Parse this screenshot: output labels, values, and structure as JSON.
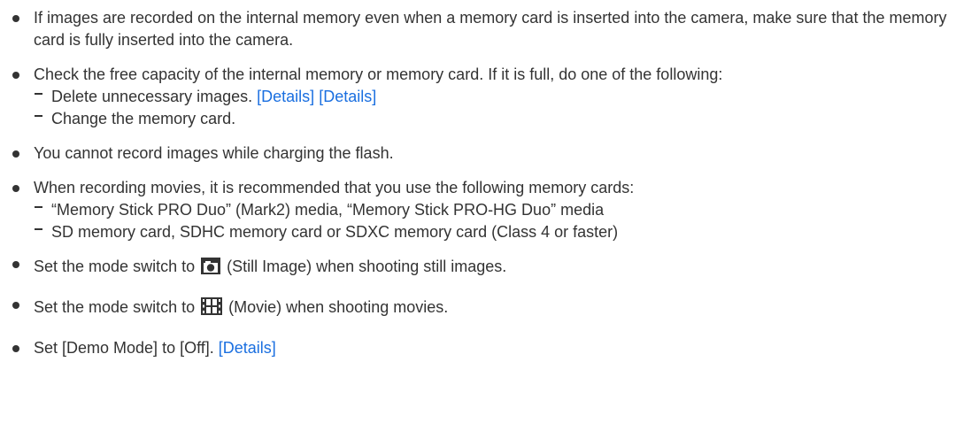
{
  "items": [
    {
      "text": "If images are recorded on the internal memory even when a memory card is inserted into the camera, make sure that the memory card is fully inserted into the camera."
    },
    {
      "text": "Check the free capacity of the internal memory or memory card. If it is full, do one of the following:",
      "subitems": [
        {
          "text": "Delete unnecessary images.",
          "link1": "[Details]",
          "link2": "[Details]"
        },
        {
          "text": "Change the memory card."
        }
      ]
    },
    {
      "text": "You cannot record images while charging the flash."
    },
    {
      "text": "When recording movies, it is recommended that you use the following memory cards:",
      "subitems": [
        {
          "text": "“Memory Stick PRO Duo” (Mark2) media, “Memory Stick PRO-HG Duo” media"
        },
        {
          "text": "SD memory card, SDHC memory card or SDXC memory card (Class 4 or faster)"
        }
      ]
    },
    {
      "before": "Set the mode switch to",
      "icon": "camera-icon",
      "after": "(Still Image) when shooting still images."
    },
    {
      "before": "Set the mode switch to",
      "icon": "film-icon",
      "after": "(Movie) when shooting movies."
    },
    {
      "text": "Set [Demo Mode] to [Off].",
      "link": "[Details]"
    }
  ]
}
